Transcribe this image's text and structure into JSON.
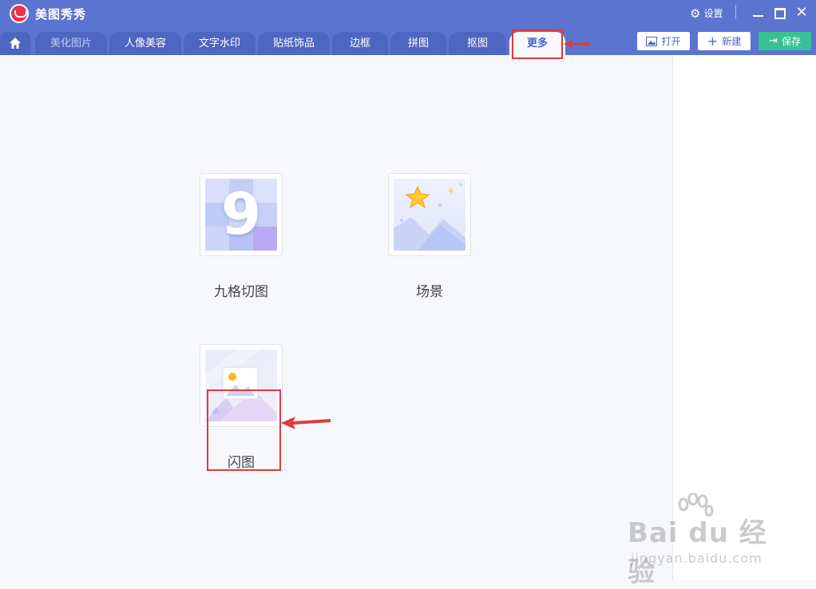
{
  "app": {
    "title": "美图秀秀"
  },
  "titlebar": {
    "settings_label": "设置",
    "close_glyph": "✕",
    "settings_icon": "⚙"
  },
  "tabs": [
    {
      "label": "美化图片",
      "state": "dim"
    },
    {
      "label": "人像美容",
      "state": "normal"
    },
    {
      "label": "文字水印",
      "state": "normal"
    },
    {
      "label": "贴纸饰品",
      "state": "normal"
    },
    {
      "label": "边框",
      "state": "normal"
    },
    {
      "label": "拼图",
      "state": "normal"
    },
    {
      "label": "抠图",
      "state": "normal"
    },
    {
      "label": "更多",
      "state": "active"
    }
  ],
  "toolbar": {
    "open_label": "打开",
    "new_label": "新建",
    "save_label": "保存",
    "new_icon": "+",
    "save_icon": "⇥"
  },
  "tools": [
    {
      "label": "九格切图",
      "icon": "nine-grid-icon",
      "thumb_text": "9"
    },
    {
      "label": "场景",
      "icon": "scene-icon"
    },
    {
      "label": "闪图",
      "icon": "flash-image-icon"
    }
  ],
  "watermark": {
    "text": "Bai du 经验",
    "sub": "jingyan.baidu.com"
  },
  "colors": {
    "primary": "#5b74cf",
    "accent": "#4b63c6",
    "save": "#36c294",
    "highlight": "#e03a3a"
  }
}
